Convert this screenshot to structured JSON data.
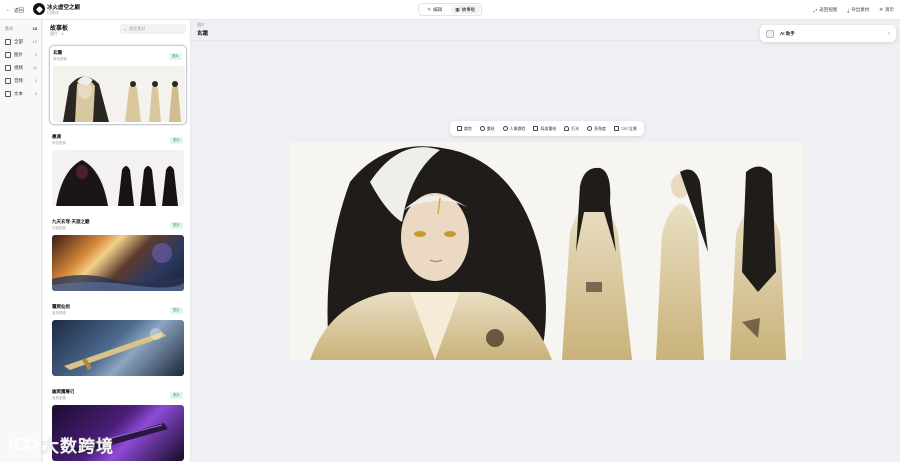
{
  "topbar": {
    "back_label": "返回",
    "project_title": "冰火虚空之巅",
    "project_sub": "已保存",
    "tabs": [
      {
        "label": "编辑",
        "icon": "pen-icon"
      },
      {
        "label": "故事板",
        "icon": "storyboard-icon"
      }
    ],
    "actions": [
      {
        "label": "返回视图",
        "icon": "expand-icon"
      },
      {
        "label": "导出素材",
        "icon": "download-icon"
      },
      {
        "label": "演示",
        "icon": "settings-icon"
      }
    ]
  },
  "nav": {
    "header_label": "素材",
    "header_count": "18",
    "items": [
      {
        "label": "全部",
        "count": "19"
      },
      {
        "label": "图片",
        "count": "4"
      },
      {
        "label": "视频",
        "count": "11"
      },
      {
        "label": "音频",
        "count": "1"
      },
      {
        "label": "文本",
        "count": "0"
      }
    ]
  },
  "panel": {
    "title": "故事板",
    "subtitle": "图片 · 6",
    "search_placeholder": "搜索素材",
    "cards": [
      {
        "title": "玄霜",
        "sub": "角色图像",
        "badge": "图片"
      },
      {
        "title": "墨渊",
        "sub": "角色图像",
        "badge": "图片"
      },
      {
        "title": "九天玄穹·天涯之巅",
        "sub": "场景图像",
        "badge": "图片"
      },
      {
        "title": "霜冥仙剑",
        "sub": "道具图像",
        "badge": "图片"
      },
      {
        "title": "幽冥魔尊刃",
        "sub": "道具图像",
        "badge": "图片"
      }
    ]
  },
  "canvas": {
    "breadcrumb": "图片",
    "title": "玄霜",
    "toolbar": [
      {
        "label": "裁剪",
        "icon": "crop-icon"
      },
      {
        "label": "重绘",
        "icon": "redraw-icon"
      },
      {
        "label": "人像换脸",
        "icon": "face-swap-icon"
      },
      {
        "label": "局部重绘",
        "icon": "inpaint-icon"
      },
      {
        "label": "打光",
        "icon": "light-icon"
      },
      {
        "label": "多角度",
        "icon": "multi-angle-icon"
      },
      {
        "label": "720°全景",
        "icon": "panorama-icon"
      }
    ]
  },
  "ai_assistant": {
    "label": "AI 助手",
    "icon": "robot-icon"
  },
  "watermark": {
    "text": "大数跨境",
    "icon": "logo-icon"
  },
  "colors": {
    "accent_green": "#3a9b6b",
    "background": "#eef0f4"
  }
}
